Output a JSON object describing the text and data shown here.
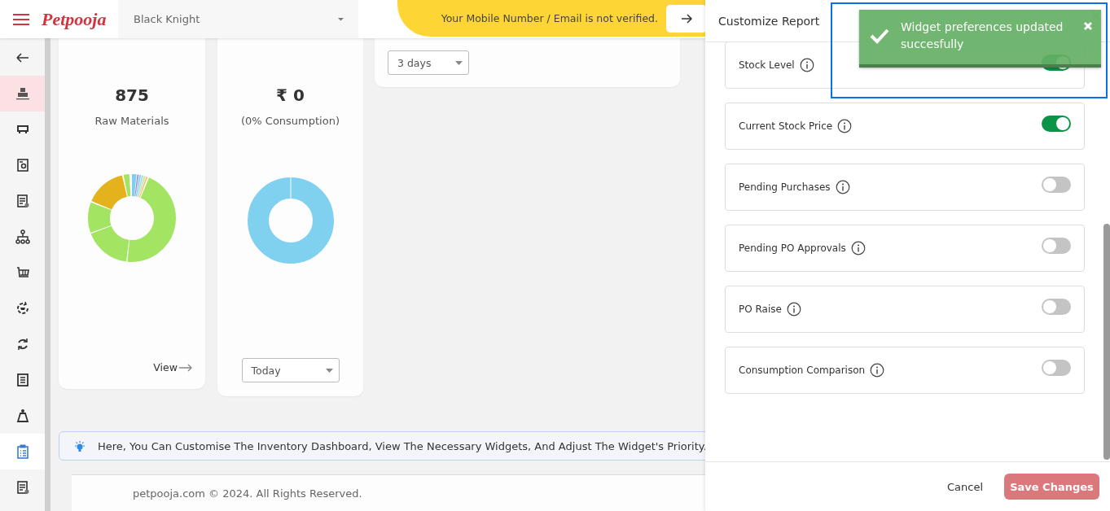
{
  "header": {
    "logo": "Petpooja",
    "outlet": "Black Knight",
    "notice": "Your Mobile Number / Email is not verified."
  },
  "sidebar": {
    "items": [
      {
        "selected": false,
        "hovered": false
      },
      {
        "selected": false,
        "hovered": true
      },
      {
        "selected": false,
        "hovered": false
      },
      {
        "selected": false,
        "hovered": false
      },
      {
        "selected": false,
        "hovered": false
      },
      {
        "selected": false,
        "hovered": false
      },
      {
        "selected": false,
        "hovered": false
      },
      {
        "selected": false,
        "hovered": false
      },
      {
        "selected": false,
        "hovered": false
      },
      {
        "selected": false,
        "hovered": false
      },
      {
        "selected": false,
        "hovered": false
      },
      {
        "selected": true,
        "hovered": false
      },
      {
        "selected": false,
        "hovered": false
      }
    ]
  },
  "widgets": [
    {
      "kind": "stock",
      "value": "875",
      "caption": "Raw Materials",
      "link": "View"
    },
    {
      "kind": "consumption",
      "value": "₹ 0",
      "caption": "(0% Consumption)",
      "period": "Today"
    },
    {
      "kind": "filter",
      "period": "3 days"
    }
  ],
  "hint": "Here, You Can Customise The Inventory Dashboard, View The Necessary Widgets, And Adjust The Widget's Priority.",
  "footer": "petpooja.com © 2024. All Rights Reserved.",
  "panel": {
    "title": "Customize Report",
    "options": [
      {
        "label": "Stock Level",
        "on": true
      },
      {
        "label": "Current Stock Price",
        "on": true
      },
      {
        "label": "Pending Purchases",
        "on": false
      },
      {
        "label": "Pending PO Approvals",
        "on": false
      },
      {
        "label": "PO Raise",
        "on": false
      },
      {
        "label": "Consumption Comparison",
        "on": false
      }
    ],
    "buttons": [
      {
        "kind": "cancel",
        "label": "Cancel"
      },
      {
        "kind": "save",
        "label": "Save Changes"
      }
    ]
  },
  "toast": {
    "message": "Widget preferences updated succesfully"
  }
}
